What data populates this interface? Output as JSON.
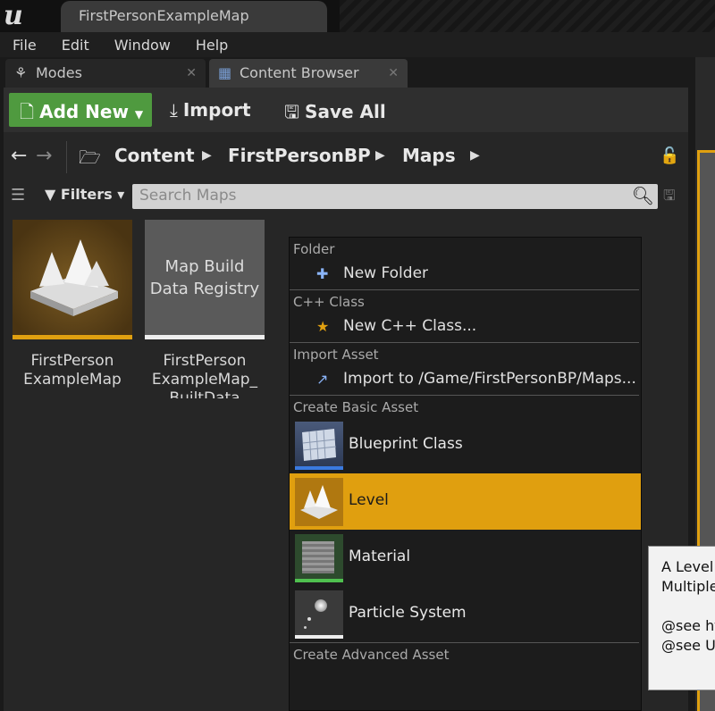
{
  "window": {
    "tab_title": "FirstPersonExampleMap"
  },
  "menu": [
    "File",
    "Edit",
    "Window",
    "Help"
  ],
  "panel_tabs": {
    "modes": "Modes",
    "content_browser": "Content Browser"
  },
  "toolbar": {
    "add_new": "Add New",
    "import": "Import",
    "save_all": "Save All"
  },
  "breadcrumb": [
    "Content",
    "FirstPersonBP",
    "Maps"
  ],
  "filters": {
    "label": "Filters",
    "search_placeholder": "Search Maps"
  },
  "assets": [
    {
      "label_line1": "FirstPerson",
      "label_line2": "ExampleMap"
    },
    {
      "thumb_line1": "Map Build",
      "thumb_line2": "Data Registry",
      "label_line1": "FirstPerson",
      "label_line2": "ExampleMap_",
      "label_line3": "BuiltData"
    }
  ],
  "context_menu": {
    "folder": {
      "header": "Folder",
      "item": "New Folder"
    },
    "cpp": {
      "header": "C++ Class",
      "item": "New C++ Class..."
    },
    "import": {
      "header": "Import Asset",
      "item": "Import to /Game/FirstPersonBP/Maps..."
    },
    "basic": {
      "header": "Create Basic Asset",
      "items": [
        "Blueprint Class",
        "Level",
        "Material",
        "Particle System"
      ],
      "selected": "Level"
    },
    "advanced": {
      "header": "Create Advanced Asset"
    }
  },
  "tooltip": {
    "line1": "A Level",
    "line2": "Multiple",
    "line3": "@see ht",
    "line4": "@see U"
  },
  "colors": {
    "accent": "#e09f0f",
    "add_new_green": "#4f9a3f",
    "menu_bg": "#1c1c1c"
  }
}
